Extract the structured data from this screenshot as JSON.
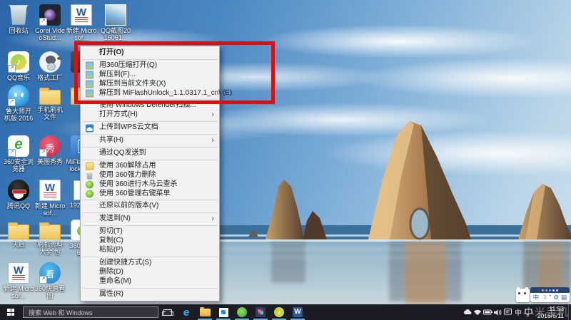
{
  "colors": {
    "annotation_box": "#dd0e0e",
    "taskbar_bg": "#1c1c24",
    "menu_bg": "#f2f2f2",
    "running_underline": "#57aee0"
  },
  "desktop": {
    "icons": [
      {
        "label": "回收站"
      },
      {
        "label": "Corel VideoStud..."
      },
      {
        "label": "新建 Microsof..."
      },
      {
        "label": "QQ截图2016061..."
      },
      {
        "label": "QQ音乐"
      },
      {
        "label": "格式工厂"
      },
      {
        "label": ""
      },
      {
        "label": "鲁大师开机版 2016"
      },
      {
        "label": "手机刷机文件"
      },
      {
        "label": ""
      },
      {
        "label": "360安全浏览器"
      },
      {
        "label": "美图秀秀"
      },
      {
        "label": "MiFlashUnlock_1..."
      },
      {
        "label": "腾讯QQ"
      },
      {
        "label": "新建 Microsof..."
      },
      {
        "label": "19201..."
      },
      {
        "label": "天启"
      },
      {
        "label": "刷机资料大全 包"
      },
      {
        "label": "360 2016..."
      },
      {
        "label": "新建 Microsof..."
      },
      {
        "label": "360快速看图"
      }
    ]
  },
  "context_menu": {
    "items": [
      {
        "label": "打开(O)"
      },
      {
        "label": "用360压缩打开(Q)"
      },
      {
        "label": "解压到(F)..."
      },
      {
        "label": "解压到当前文件夹(X)"
      },
      {
        "label": "解压到 MiFlashUnlock_1.1.0317.1_cn\\ (E)"
      },
      {
        "label": "使用 Windows Defender扫描..."
      },
      {
        "label": "打开方式(H)"
      },
      {
        "label": "上传到WPS云文档"
      },
      {
        "label": "共享(H)"
      },
      {
        "label": "通过QQ发送到"
      },
      {
        "label": "使用 360解除占用"
      },
      {
        "label": "使用 360强力删除"
      },
      {
        "label": "使用 360进行木马云查杀"
      },
      {
        "label": "使用 360管理右键菜单"
      },
      {
        "label": "还原以前的版本(V)"
      },
      {
        "label": "发送到(N)"
      },
      {
        "label": "剪切(T)"
      },
      {
        "label": "复制(C)"
      },
      {
        "label": "粘贴(P)"
      },
      {
        "label": "创建快捷方式(S)"
      },
      {
        "label": "删除(D)"
      },
      {
        "label": "重命名(M)"
      },
      {
        "label": "属性(R)"
      }
    ],
    "submenu_arrow": "›"
  },
  "taskbar": {
    "search_placeholder": "搜索 Web 和 Windows",
    "input_indicator": "中",
    "clock_time": "11:53",
    "clock_date": "2016/6/11"
  },
  "ime": {
    "mode_label": "中",
    "moon_icon": "☽",
    "punct_icon": "’’",
    "tool_icon": "⚙",
    "board_icon": "▤"
  },
  "watermark": {
    "text": "小米手机"
  }
}
